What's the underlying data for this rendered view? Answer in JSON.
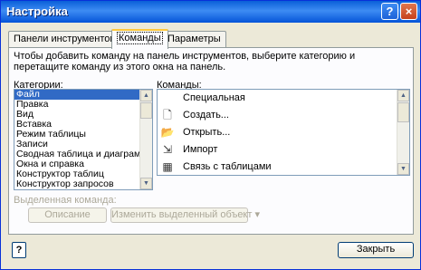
{
  "window": {
    "title": "Настройка"
  },
  "titlebar": {
    "help_glyph": "?",
    "close_glyph": "×"
  },
  "tabs": [
    {
      "label": "Панели инструментов",
      "active": false
    },
    {
      "label": "Команды",
      "active": true
    },
    {
      "label": "Параметры",
      "active": false
    }
  ],
  "instructions": "Чтобы добавить команду на панель инструментов, выберите категорию и перетащите команду из этого окна на панель.",
  "categories": {
    "label": "Категории:",
    "items": [
      "Файл",
      "Правка",
      "Вид",
      "Вставка",
      "Режим таблицы",
      "Записи",
      "Сводная таблица и диаграмма",
      "Окна и справка",
      "Конструктор таблиц",
      "Конструктор запросов"
    ],
    "selected_index": 0
  },
  "commands": {
    "label": "Команды:",
    "items": [
      {
        "icon": "blank-icon",
        "glyph": "",
        "label": "Специальная"
      },
      {
        "icon": "new-document-icon",
        "glyph": "🗋",
        "label": "Создать..."
      },
      {
        "icon": "open-folder-icon",
        "glyph": "📂",
        "label": "Открыть..."
      },
      {
        "icon": "import-icon",
        "glyph": "⇲",
        "label": "Импорт"
      },
      {
        "icon": "link-tables-icon",
        "glyph": "▦",
        "label": "Связь с таблицами"
      }
    ]
  },
  "selected_command": {
    "label": "Выделенная команда:",
    "description_button": "Описание",
    "modify_button": "Изменить выделенный объект",
    "modify_arrow": "▾"
  },
  "footer": {
    "help_glyph": "?",
    "close_button": "Закрыть"
  },
  "colors": {
    "title_blue": "#0a5fd8",
    "selection": "#316ac5",
    "tab_highlight": "#ffc83c"
  }
}
